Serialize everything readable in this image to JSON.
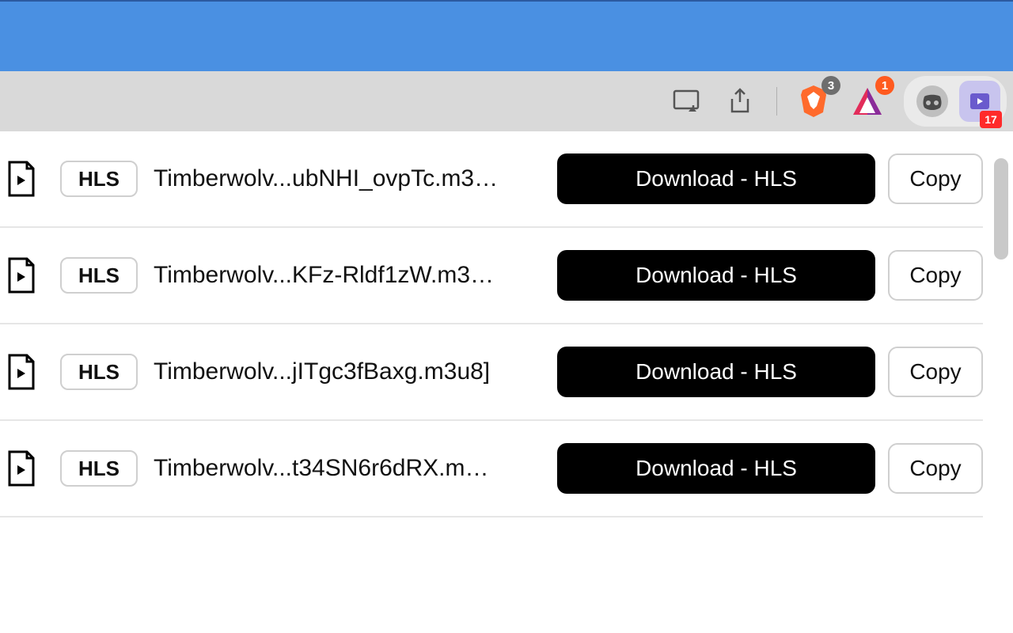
{
  "toolbar": {
    "brave_badge": "3",
    "triangle_badge": "1",
    "ext_badge": "17"
  },
  "rows": [
    {
      "format_badge": "HLS",
      "filename": "Timberwolv...ubNHI_ovpTc.m3…",
      "download_label": "Download - HLS",
      "copy_label": "Copy"
    },
    {
      "format_badge": "HLS",
      "filename": "Timberwolv...KFz-Rldf1zW.m3…",
      "download_label": "Download - HLS",
      "copy_label": "Copy"
    },
    {
      "format_badge": "HLS",
      "filename": "Timberwolv...jITgc3fBaxg.m3u8]",
      "download_label": "Download - HLS",
      "copy_label": "Copy"
    },
    {
      "format_badge": "HLS",
      "filename": "Timberwolv...t34SN6r6dRX.m…",
      "download_label": "Download - HLS",
      "copy_label": "Copy"
    }
  ]
}
